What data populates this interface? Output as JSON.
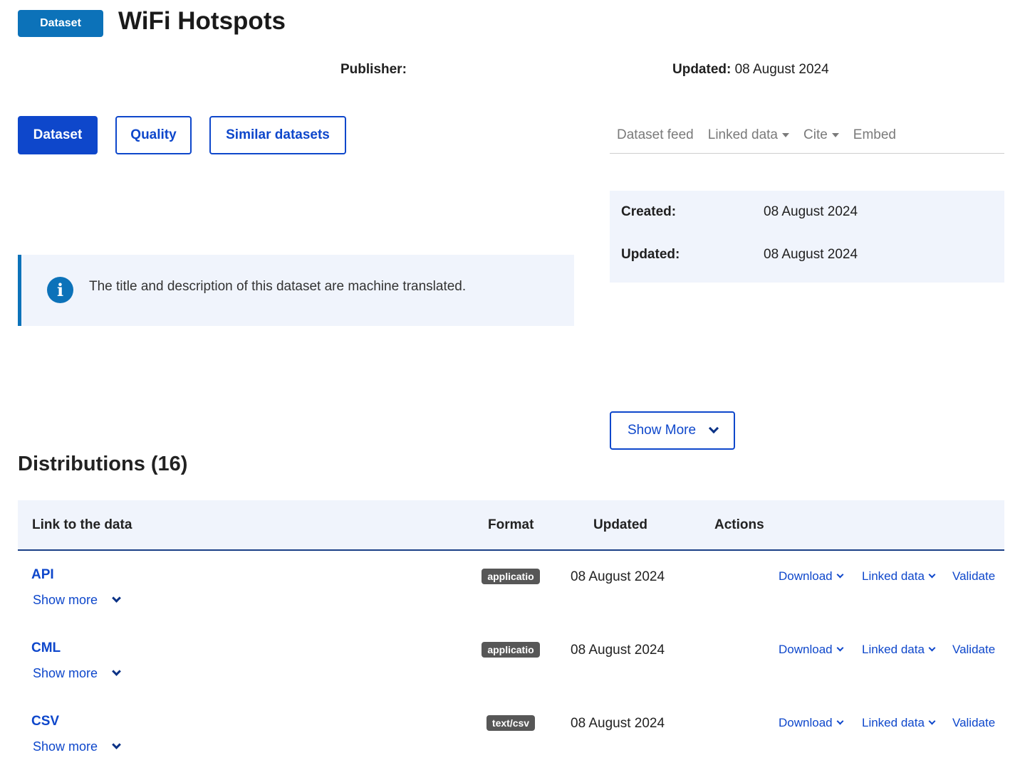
{
  "header": {
    "badge": "Dataset",
    "title": "WiFi Hotspots",
    "publisher_label": "Publisher:",
    "updated_label": "Updated:",
    "updated_value": "08 August 2024"
  },
  "tabs": [
    {
      "label": "Dataset",
      "active": true
    },
    {
      "label": "Quality",
      "active": false
    },
    {
      "label": "Similar datasets",
      "active": false
    }
  ],
  "top_links": [
    {
      "label": "Dataset feed",
      "dropdown": false
    },
    {
      "label": "Linked data",
      "dropdown": true
    },
    {
      "label": "Cite",
      "dropdown": true
    },
    {
      "label": "Embed",
      "dropdown": false
    }
  ],
  "info": {
    "created_label": "Created:",
    "created_value": "08 August 2024",
    "updated_label": "Updated:",
    "updated_value": "08 August 2024"
  },
  "alert": {
    "icon": "info-icon",
    "text": "The title and description of this dataset are machine translated."
  },
  "show_more_button": "Show More",
  "distributions": {
    "title": "Distributions (16)",
    "columns": [
      "Link to the data",
      "Format",
      "Updated",
      "Actions"
    ],
    "rows": [
      {
        "title": "API",
        "show_more": "Show more",
        "format": "applicatio",
        "updated": "08 August 2024",
        "download": "Download",
        "linked_data": "Linked data",
        "validate": "Validate"
      },
      {
        "title": "CML",
        "show_more": "Show more",
        "format": "applicatio",
        "updated": "08 August 2024",
        "download": "Download",
        "linked_data": "Linked data",
        "validate": "Validate"
      },
      {
        "title": "CSV",
        "show_more": "Show more",
        "format": "text/csv",
        "updated": "08 August 2024",
        "download": "Download",
        "linked_data": "Linked data",
        "validate": "Validate"
      }
    ]
  },
  "colors": {
    "primary": "#0e47cb",
    "badge": "#0c72b9",
    "panel_bg": "#f0f4fc",
    "format_badge": "#575757"
  }
}
